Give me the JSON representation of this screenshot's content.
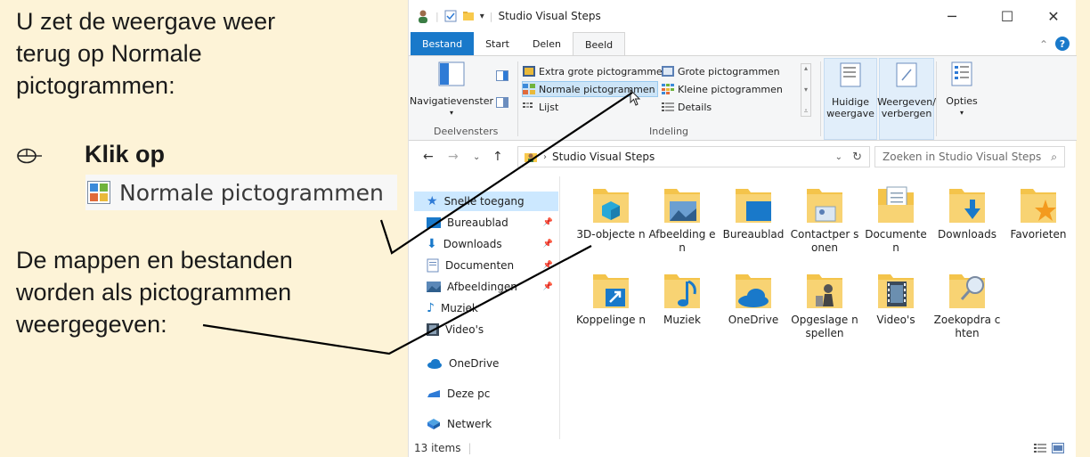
{
  "instructions": {
    "line1": "U zet de weergave weer",
    "line2": "terug op Normale",
    "line3": "pictogrammen:",
    "click_label": "Klik op",
    "button_sample_label": "Normale pictogrammen",
    "line4": "De mappen en bestanden",
    "line5": "worden als pictogrammen",
    "line6": "weergegeven:"
  },
  "window": {
    "title": "Studio Visual Steps",
    "tabs": [
      "Bestand",
      "Start",
      "Delen",
      "Beeld"
    ],
    "active_tab": "Beeld",
    "colors": {
      "accent": "#1979ca",
      "selected": "#cce8ff",
      "help": "#1979ca"
    }
  },
  "ribbon": {
    "panes_group": {
      "button": "Navigatievenster",
      "label": "Deelvensters"
    },
    "layout_group": {
      "label": "Indeling",
      "items": [
        "Extra grote pictogrammen",
        "Grote pictogrammen",
        "Normale pictogrammen",
        "Kleine pictogrammen",
        "Lijst",
        "Details"
      ],
      "selected": "Normale pictogrammen"
    },
    "current_view": {
      "line1": "Huidige",
      "line2": "weergave"
    },
    "show_hide": {
      "line1": "Weergeven/",
      "line2": "verbergen"
    },
    "options": "Opties"
  },
  "address": {
    "path": "Studio Visual Steps",
    "search_placeholder": "Zoeken in Studio Visual Steps"
  },
  "nav": {
    "items": [
      {
        "label": "Snelle toegang",
        "icon": "star-icon"
      },
      {
        "label": "Bureaublad",
        "icon": "desktop-icon",
        "pinned": true
      },
      {
        "label": "Downloads",
        "icon": "download-icon",
        "pinned": true
      },
      {
        "label": "Documenten",
        "icon": "document-icon",
        "pinned": true
      },
      {
        "label": "Afbeeldingen",
        "icon": "pictures-icon",
        "pinned": true
      },
      {
        "label": "Muziek",
        "icon": "music-icon"
      },
      {
        "label": "Video's",
        "icon": "video-icon"
      },
      {
        "label": "OneDrive",
        "icon": "cloud-icon"
      },
      {
        "label": "Deze pc",
        "icon": "pc-icon"
      },
      {
        "label": "Netwerk",
        "icon": "network-icon"
      }
    ]
  },
  "files": [
    {
      "name": "3D-objecten",
      "display": "3D-objecte n",
      "icon": "3d-objects-icon"
    },
    {
      "name": "Afbeeldingen",
      "display": "Afbeelding en",
      "icon": "pictures-folder-icon"
    },
    {
      "name": "Bureaublad",
      "display": "Bureaublad",
      "icon": "desktop-folder-icon"
    },
    {
      "name": "Contactpersonen",
      "display": "Contactper sonen",
      "icon": "contacts-folder-icon"
    },
    {
      "name": "Documenten",
      "display": "Documente n",
      "icon": "documents-folder-icon"
    },
    {
      "name": "Downloads",
      "display": "Downloads",
      "icon": "downloads-folder-icon"
    },
    {
      "name": "Favorieten",
      "display": "Favorieten",
      "icon": "favorites-folder-icon"
    },
    {
      "name": "Koppelingen",
      "display": "Koppelinge n",
      "icon": "links-folder-icon"
    },
    {
      "name": "Muziek",
      "display": "Muziek",
      "icon": "music-folder-icon"
    },
    {
      "name": "OneDrive",
      "display": "OneDrive",
      "icon": "onedrive-folder-icon"
    },
    {
      "name": "Opgeslagen spellen",
      "display": "Opgeslage n spellen",
      "icon": "saved-games-folder-icon"
    },
    {
      "name": "Video's",
      "display": "Video's",
      "icon": "videos-folder-icon"
    },
    {
      "name": "Zoekopdrachten",
      "display": "Zoekopdra chten",
      "icon": "searches-folder-icon"
    }
  ],
  "status": {
    "items_count": "13 items"
  }
}
